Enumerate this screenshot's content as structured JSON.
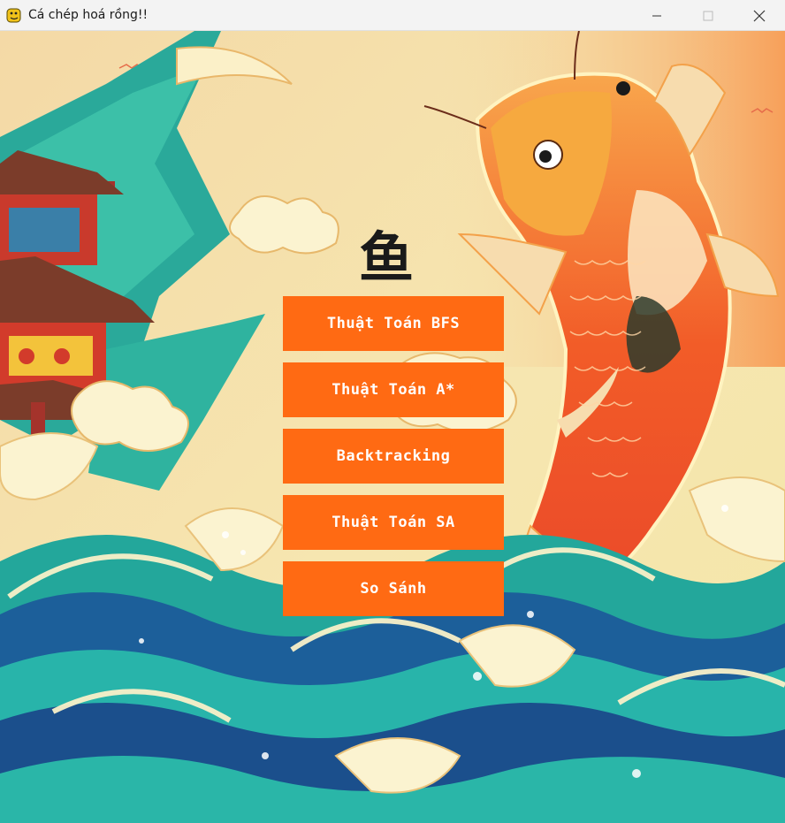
{
  "window": {
    "title": "Cá chép hoá rồng!!",
    "app_icon": "pygame-snake-icon",
    "controls": {
      "minimize_icon": "minimize-icon",
      "maximize_icon": "maximize-icon",
      "close_icon": "close-icon"
    }
  },
  "background": {
    "description_icon": "koi-fish-waves-illustration",
    "calligraphy_char": "鱼"
  },
  "menu": {
    "buttons": [
      {
        "label": "Thuật Toán BFS"
      },
      {
        "label": "Thuật Toán A*"
      },
      {
        "label": "Backtracking"
      },
      {
        "label": "Thuật Toán SA"
      },
      {
        "label": "So Sánh"
      }
    ]
  },
  "colors": {
    "button_bg": "#ff6a13",
    "button_text": "#ffffff",
    "titlebar_bg": "#f3f3f3"
  }
}
